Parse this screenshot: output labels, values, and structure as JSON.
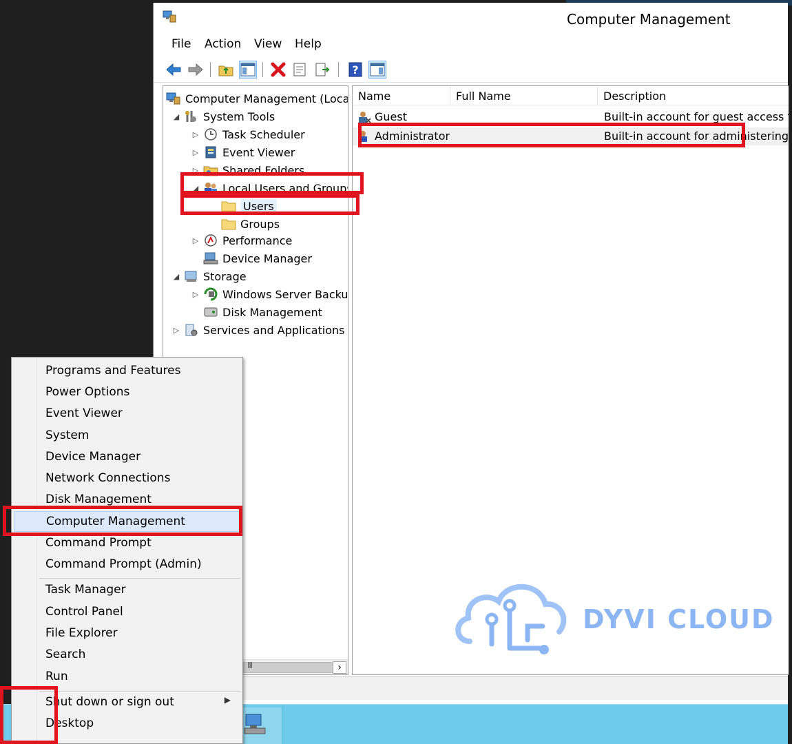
{
  "window": {
    "title": "Computer Management"
  },
  "menubar": {
    "items": [
      "File",
      "Action",
      "View",
      "Help"
    ]
  },
  "toolbar": {
    "buttons": [
      "back-icon",
      "forward-icon",
      "up-folder-icon",
      "show-hide-tree-icon",
      "delete-icon",
      "properties-icon",
      "export-list-icon",
      "help-icon",
      "show-hide-action-pane-icon"
    ]
  },
  "tree": {
    "root": "Computer Management (Local",
    "system_tools": "System Tools",
    "task_scheduler": "Task Scheduler",
    "event_viewer": "Event Viewer",
    "shared_folders": "Shared Folders",
    "local_users_groups": "Local Users and Groups",
    "users": "Users",
    "groups": "Groups",
    "performance": "Performance",
    "device_manager": "Device Manager",
    "storage": "Storage",
    "windows_server_backup": "Windows Server Backup",
    "disk_management": "Disk Management",
    "services_apps": "Services and Applications"
  },
  "list": {
    "columns": [
      "Name",
      "Full Name",
      "Description"
    ],
    "rows": [
      {
        "name": "Guest",
        "full_name": "",
        "description": "Built-in account for guest access t..."
      },
      {
        "name": "Administrator",
        "full_name": "",
        "description": "Built-in account for administering..."
      }
    ]
  },
  "watermark": {
    "text": "DYVI CLOUD"
  },
  "context_menu": {
    "group1": [
      "Programs and Features",
      "Power Options",
      "Event Viewer",
      "System",
      "Device Manager",
      "Network Connections",
      "Disk Management",
      "Computer Management",
      "Command Prompt",
      "Command Prompt (Admin)"
    ],
    "group2": [
      "Task Manager",
      "Control Panel",
      "File Explorer",
      "Search",
      "Run"
    ],
    "group3": [
      "Shut down or sign out",
      "Desktop"
    ]
  },
  "colors": {
    "highlight_box": "#e0141e",
    "taskbar": "#6ecbe9",
    "menu_hover": "#dbe9fb"
  }
}
